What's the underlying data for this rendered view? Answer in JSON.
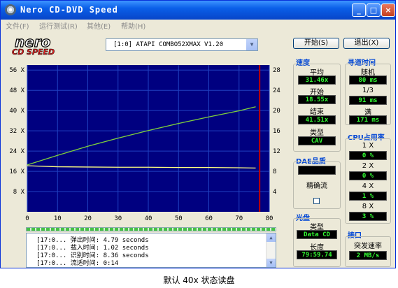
{
  "window": {
    "title": "Nero CD-DVD Speed",
    "controls": {
      "minimize": "_",
      "maximize": "□",
      "close": "×"
    }
  },
  "menu": [
    "文件(F)",
    "运行测试(R)",
    "其他(E)",
    "帮助(H)"
  ],
  "logo": {
    "line1": "nero",
    "line2": "CD SPEED"
  },
  "drive": {
    "selected": "[1:0]   ATAPI COMBO52XMAX V1.20"
  },
  "buttons": {
    "start": "开始(S)",
    "exit": "退出(X)"
  },
  "speed_panel": {
    "title": "速度",
    "average_label": "平均",
    "average_value": "31.46x",
    "start_label": "开始",
    "start_value": "18.55x",
    "end_label": "结束",
    "end_value": "41.51x",
    "type_label": "类型",
    "type_value": "CAV"
  },
  "seek_panel": {
    "title": "寻道时间",
    "random_label": "随机",
    "random_value": "80 ms",
    "third_label": "1/3",
    "third_value": "91 ms",
    "full_label": "满",
    "full_value": "171 ms"
  },
  "cpu_panel": {
    "title": "CPU占用率",
    "rows": [
      {
        "label": "1 X",
        "value": "0 %"
      },
      {
        "label": "2 X",
        "value": "0 %"
      },
      {
        "label": "4 X",
        "value": "1 %"
      },
      {
        "label": "8 X",
        "value": "3 %"
      }
    ]
  },
  "dae_panel": {
    "title": "DAE品质",
    "accurate_stream_label": "精确流"
  },
  "disc_panel": {
    "title": "光盘",
    "type_label": "类型",
    "type_value": "Data CD",
    "length_label": "长度",
    "length_value": "79:59.74"
  },
  "interface_panel": {
    "title": "接口",
    "burst_label": "突发速率",
    "burst_value": "2 MB/s"
  },
  "log": [
    {
      "time": "[17:0...",
      "label": "弹出时间:",
      "value": "4.79 seconds"
    },
    {
      "time": "[17:0...",
      "label": "载入时间:",
      "value": "1.02 seconds"
    },
    {
      "time": "[17:0...",
      "label": "识别时间:",
      "value": "8.36 seconds"
    },
    {
      "time": "[17:0...",
      "label": "流适时间:",
      "value": "0:14"
    }
  ],
  "caption": "默认 40x 状态读盘",
  "colors": {
    "chart_bg": "#000080",
    "grid": "#2040c0",
    "speed_line": "#7fd13b",
    "rotation_line": "#ffff80",
    "end_marker": "#c00000",
    "lcd_text": "#33ff33"
  },
  "chart_data": {
    "type": "line",
    "x_ticks": [
      0,
      10,
      20,
      30,
      40,
      50,
      60,
      70,
      80
    ],
    "xlim": [
      0,
      80
    ],
    "left_ticks": [
      "8 X",
      "16 X",
      "24 X",
      "32 X",
      "40 X",
      "48 X",
      "56 X"
    ],
    "left_ylim": [
      0,
      58
    ],
    "right_ticks": [
      4,
      8,
      12,
      16,
      20,
      24,
      28
    ],
    "right_ylim": [
      0,
      29
    ],
    "series": [
      {
        "x": [
          0,
          10,
          20,
          30,
          40,
          50,
          60,
          70,
          75.5
        ],
        "y": [
          18.55,
          22.3,
          25.9,
          29.1,
          32.1,
          34.9,
          37.5,
          39.9,
          41.51
        ],
        "axis": "left"
      },
      {
        "x": [
          0,
          10,
          20,
          30,
          40,
          50,
          60,
          70,
          75.5
        ],
        "y": [
          18.2,
          17.8,
          17.7,
          17.6,
          17.6,
          17.5,
          17.5,
          17.4,
          17.3
        ],
        "axis": "left"
      }
    ],
    "end_marker_x": 76.8
  }
}
